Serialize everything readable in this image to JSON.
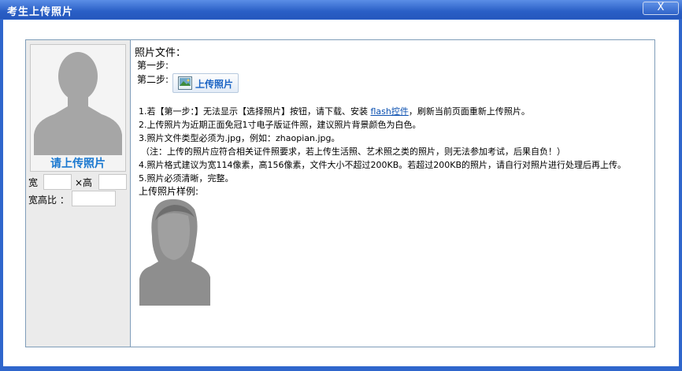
{
  "window": {
    "title": "考生上传照片",
    "close_label": "X"
  },
  "left": {
    "upload_prompt": "请上传照片",
    "width_label": "宽",
    "height_label": "×高",
    "ratio_label": "宽高比 ：",
    "width_value": "",
    "height_value": "",
    "ratio_value": ""
  },
  "right": {
    "photo_file_label": "照片文件：",
    "step1": "第一步:",
    "step2": "第二步:",
    "upload_button": "上传照片",
    "notes": {
      "n1_prefix": "1.若【第一步：】无法显示【选择照片】按钮，请下载、安装",
      "n1_link": "flash控件",
      "n1_suffix": "，刷新当前页面重新上传照片。",
      "n2": "2.上传照片为近期正面免冠1寸电子版证件照，建议照片背景颜色为白色。",
      "n3": "3.照片文件类型必须为.jpg，例如：zhaopian.jpg。",
      "n3b": "（注：上传的照片应符合相关证件照要求，若上传生活照、艺术照之类的照片，则无法参加考试，后果自负！）",
      "n4": "4.照片格式建议为宽114像素，高156像素，文件大小不超过200KB。若超过200KB的照片，请自行对照片进行处理后再上传。",
      "n5": "5.照片必须清晰，完整。"
    },
    "sample_label": "上传照片样例:"
  },
  "colors": {
    "titlebar": "#2a5fc6",
    "frame_border": "#7f9db9",
    "prompt_blue": "#1a78d0",
    "left_panel_bg": "#ebebeb"
  }
}
